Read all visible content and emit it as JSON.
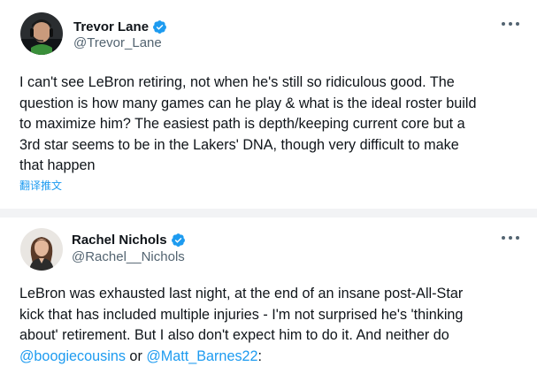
{
  "tweets": [
    {
      "display_name": "Trevor Lane",
      "handle": "@Trevor_Lane",
      "verified": true,
      "avatar_icon": "avatar-man-headset",
      "more_icon": "more-horizontal-icon",
      "body_lines": [
        "I can't see LeBron retiring, not when he's still so ridiculous good. The",
        "question is how many games can he play & what is the ideal roster build",
        "to maximize him? The easiest path is depth/keeping current core but a",
        "3rd star seems to be in the Lakers' DNA, though very difficult to make",
        "that happen"
      ],
      "translate_label": "翻译推文"
    },
    {
      "display_name": "Rachel Nichols",
      "handle": "@Rachel__Nichols",
      "verified": true,
      "avatar_icon": "avatar-woman",
      "more_icon": "more-horizontal-icon",
      "body_lines": [
        "LeBron was exhausted last night, at the end of an insane post-All-Star",
        "kick that has included multiple injuries - I'm not surprised he's 'thinking",
        "about' retirement. But I also don't expect him to do it. And neither do"
      ],
      "last_line": {
        "mention_1": "@boogiecousins",
        "connector": " or ",
        "mention_2": "@Matt_Barnes22",
        "suffix": ":"
      }
    }
  ],
  "colors": {
    "text": "#0f1419",
    "secondary": "#536471",
    "link": "#1d9bf0",
    "verified": "#1d9bf0",
    "divider": "#f2f3f5"
  }
}
